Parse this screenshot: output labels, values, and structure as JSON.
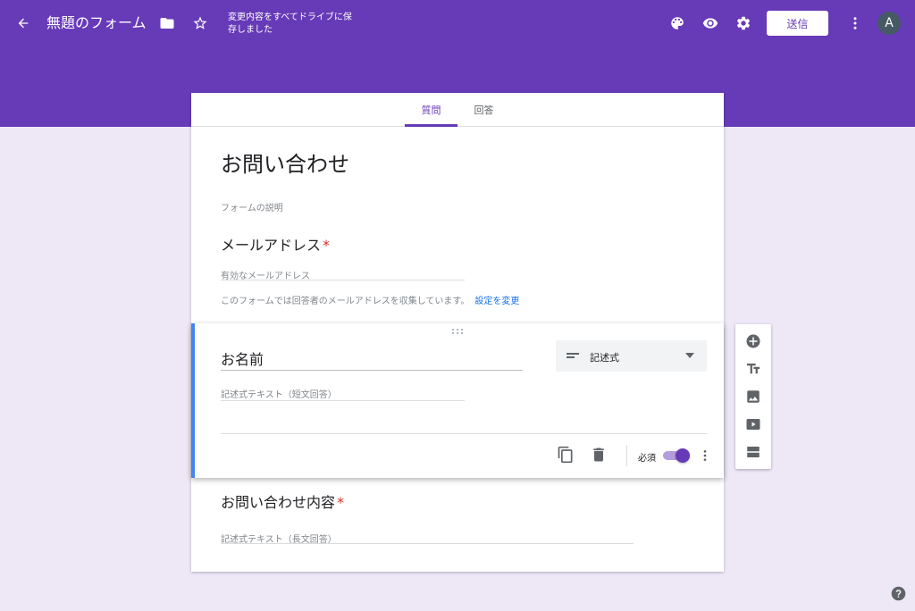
{
  "header": {
    "title": "無題のフォーム",
    "save_status": "変更内容をすべてドライブに保存しました",
    "send_label": "送信",
    "avatar_initial": "A",
    "icons": [
      "arrow-back-icon",
      "folder-icon",
      "star-icon",
      "palette-icon",
      "preview-eye-icon",
      "settings-gear-icon",
      "more-vert-icon"
    ]
  },
  "tabs": [
    {
      "label": "質問",
      "active": true
    },
    {
      "label": "回答",
      "active": false
    }
  ],
  "form": {
    "title": "お問い合わせ",
    "description_placeholder": "フォームの説明",
    "email_question": {
      "title": "メールアドレス",
      "required_mark": "*",
      "placeholder": "有効なメールアドレス",
      "note": "このフォームでは回答者のメールアドレスを収集しています。",
      "settings_link": "設定を変更"
    },
    "active_question": {
      "title": "お名前",
      "type_label": "記述式",
      "answer_placeholder": "記述式テキスト（短文回答）",
      "required_label": "必須",
      "required_on": true
    },
    "inquiry_question": {
      "title": "お問い合わせ内容",
      "required_mark": "*",
      "answer_placeholder": "記述式テキスト（長文回答）"
    }
  },
  "side_toolbar": [
    "add-question-icon",
    "add-title-icon",
    "add-image-icon",
    "add-video-icon",
    "add-section-icon"
  ],
  "colors": {
    "theme": "#673ab7",
    "background": "#ede7f6",
    "active_bar": "#4285f4",
    "required": "#d93025",
    "link": "#1a73e8"
  }
}
